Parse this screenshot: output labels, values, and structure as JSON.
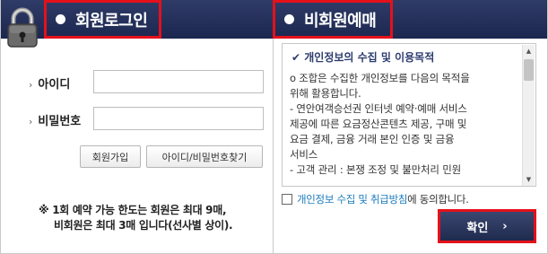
{
  "login": {
    "tab_label": "회원로그인",
    "id_label": "아이디",
    "password_label": "비밀번호",
    "id_value": "",
    "password_value": "",
    "join_button": "회원가입",
    "find_button": "아이디/비밀번호찾기",
    "note_line1": "※ 1회 예약 가능 한도는 회원은 최대 9매,",
    "note_line2": "비회원은 최대 3매 입니다(선사별 상이)."
  },
  "guest": {
    "tab_label": "비회원예매",
    "terms_title": "개인정보의 수집 및 이용목적",
    "terms_lines": [
      "o 조합은 수집한 개인정보를 다음의 목적을",
      "위해 활용합니다.",
      "- 연안여객승선권 인터넷 예약·예매 서비스",
      "제공에 따른 요금정산콘텐츠 제공, 구매 및",
      "요금 결제, 금융 거래 본인 인증 및 금융",
      "서비스",
      "- 고객 관리 : 본쟁 조정 및 불만처리 민원"
    ],
    "agree_link": "개인정보 수집 및 취급방침",
    "agree_text": "에 동의합니다.",
    "agree_checked": false,
    "confirm_button": "확인",
    "confirm_arrow": "›"
  },
  "icons": {
    "lock": "lock-icon",
    "check": "✔",
    "chevron": "›"
  },
  "colors": {
    "header": "#25315b",
    "highlight": "#e4111b",
    "link": "#1c7bbd"
  }
}
